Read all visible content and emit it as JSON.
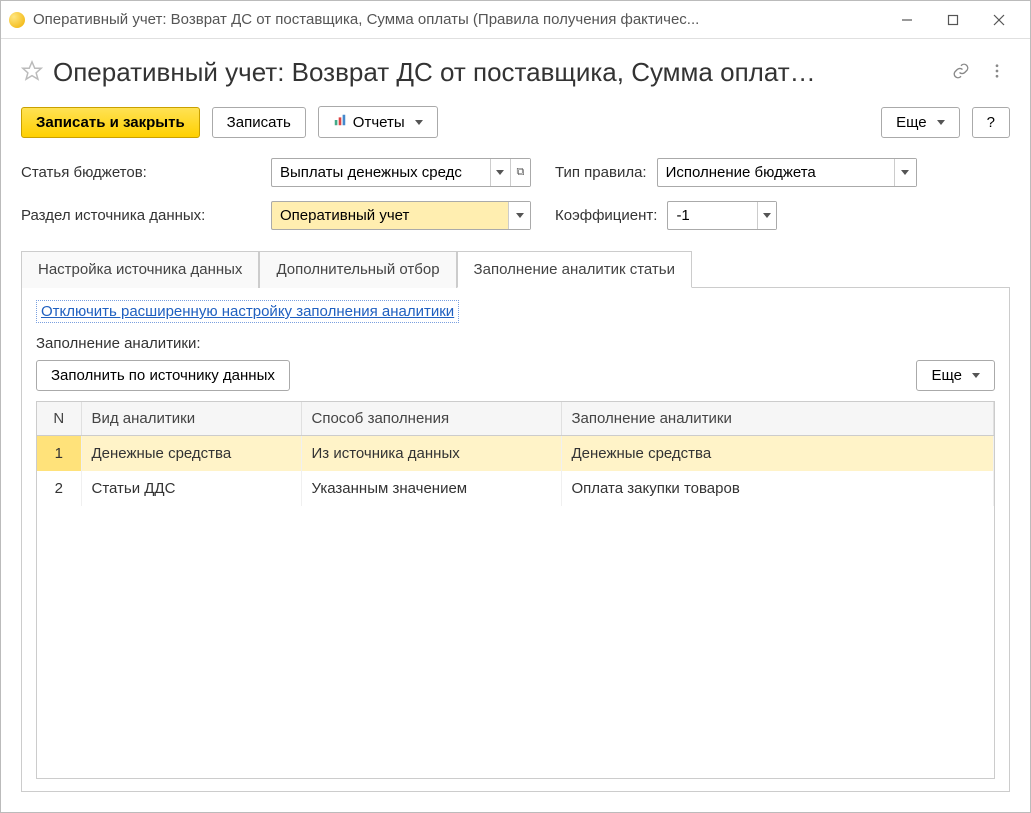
{
  "window": {
    "title": "Оперативный учет: Возврат ДС от поставщика, Сумма оплаты (Правила получения фактичес..."
  },
  "page": {
    "title": "Оперативный учет: Возврат ДС от поставщика, Сумма оплат…"
  },
  "toolbar": {
    "save_close": "Записать и закрыть",
    "save": "Записать",
    "reports": "Отчеты",
    "more": "Еще",
    "help": "?"
  },
  "form": {
    "budget_article_label": "Статья бюджетов:",
    "budget_article_value": "Выплаты денежных средс",
    "rule_type_label": "Тип правила:",
    "rule_type_value": "Исполнение бюджета",
    "source_section_label": "Раздел источника данных:",
    "source_section_value": "Оперативный учет",
    "coefficient_label": "Коэффициент:",
    "coefficient_value": "-1"
  },
  "tabs": {
    "t1": "Настройка источника данных",
    "t2": "Дополнительный отбор",
    "t3": "Заполнение аналитик статьи"
  },
  "panel": {
    "disable_link": "Отключить расширенную настройку заполнения аналитики",
    "fill_label": "Заполнение аналитики:",
    "fill_by_source": "Заполнить по источнику данных",
    "more": "Еще"
  },
  "table": {
    "headers": {
      "n": "N",
      "type": "Вид аналитики",
      "method": "Способ заполнения",
      "fill": "Заполнение аналитики"
    },
    "rows": [
      {
        "n": "1",
        "type": "Денежные средства",
        "method": "Из источника данных",
        "fill": "Денежные средства"
      },
      {
        "n": "2",
        "type": "Статьи ДДС",
        "method": "Указанным значением",
        "fill": "Оплата закупки товаров"
      }
    ]
  }
}
